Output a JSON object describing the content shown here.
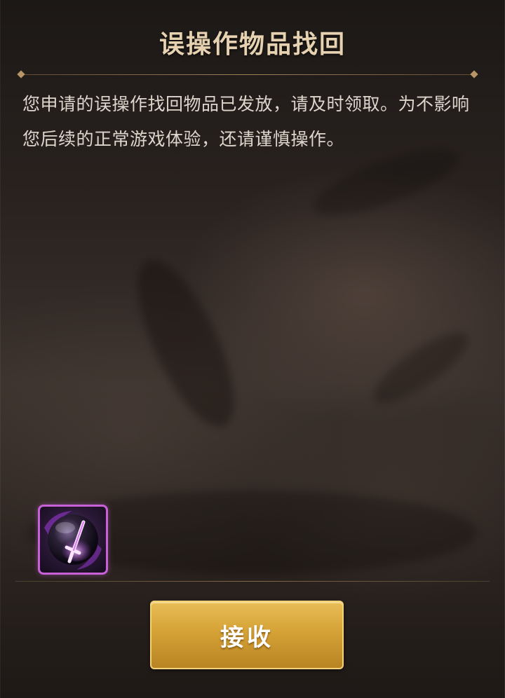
{
  "dialog": {
    "title": "误操作物品找回",
    "message": "您申请的误操作找回物品已发放，请及时领取。为不影响您后续的正常游戏体验，还请谨慎操作。"
  },
  "reward": {
    "icon": "purple-sword-orb-icon",
    "rarity_color": "#c860d8"
  },
  "actions": {
    "receive_label": "接收"
  },
  "colors": {
    "title": "#e6d2b0",
    "text": "#ddd6cc",
    "button_gold": "#d5a236",
    "divider": "#b89466"
  }
}
